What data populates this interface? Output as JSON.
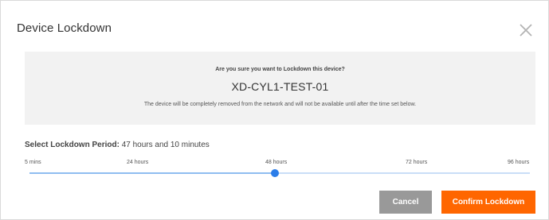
{
  "dialog": {
    "title": "Device Lockdown",
    "close_icon": "close-icon"
  },
  "confirmation": {
    "question": "Are you sure you want to Lockdown this device?",
    "device_name": "XD-CYL1-TEST-01",
    "warning": "The device will be completely removed from the network and will not be available until after the time set below."
  },
  "period": {
    "label": "Select Lockdown Period:",
    "value_text": "47 hours and 10 minutes"
  },
  "slider": {
    "ticks": [
      "5 mins",
      "24 hours",
      "48 hours",
      "72 hours",
      "96 hours"
    ],
    "value_fraction": 0.49
  },
  "buttons": {
    "cancel": "Cancel",
    "confirm": "Confirm Lockdown"
  },
  "colors": {
    "confirm": "#ff6600",
    "cancel": "#999999",
    "slider_thumb": "#2b7de9"
  }
}
